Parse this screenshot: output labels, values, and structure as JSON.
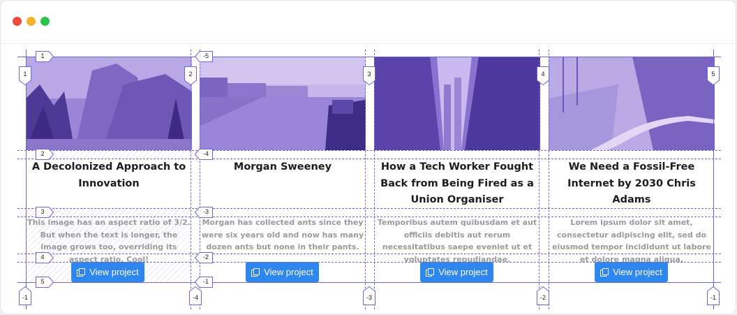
{
  "window": {
    "controls": {
      "close_color": "#ee4c3c",
      "minimize_color": "#f6b42a",
      "maximize_color": "#2ac64a"
    }
  },
  "cards": [
    {
      "title": "A Decolonized Approach to Innovation",
      "description": "This image has an aspect ratio of 3/2. But when the text is longer, the image grows too, overriding its aspect ratio. Cool!",
      "button_label": "View project",
      "button_icon": "copy-icon",
      "image": "mountain-valley-photo"
    },
    {
      "title": "Morgan Sweeney",
      "description": "Morgan has collected ants since they were six years old and now has many dozen ants but none in their pants.",
      "button_label": "View project",
      "button_icon": "copy-icon",
      "image": "river-boat-photo"
    },
    {
      "title": "How a Tech Worker Fought Back from Being Fired as a Union Organiser",
      "description": "Temporibus autem quibusdam et aut officiis debitis aut rerum necessitatibus saepe eveniet ut et voluptates repudiandae.",
      "button_label": "View project",
      "button_icon": "copy-icon",
      "image": "city-buildings-photo"
    },
    {
      "title": "We Need a Fossil-Free Internet by 2030 Chris Adams",
      "description": "Lorem ipsum dolor sit amet, consectetur adipiscing elit, sed do eiusmod tempor incididunt ut labore et dolore magna aliqua.",
      "button_label": "View project",
      "button_icon": "copy-icon",
      "image": "forest-road-photo"
    }
  ],
  "grid_overlay": {
    "line_color": "#6a66d6",
    "row_labels": [
      "1",
      "2",
      "3",
      "4",
      "5"
    ],
    "row_labels_negative": [
      "-5",
      "-4",
      "-3",
      "-2",
      "-1"
    ],
    "column_labels": [
      "1",
      "2",
      "3",
      "4",
      "5"
    ],
    "column_labels_negative": [
      "-1",
      "-4",
      "-3",
      "-2",
      "-1"
    ]
  }
}
